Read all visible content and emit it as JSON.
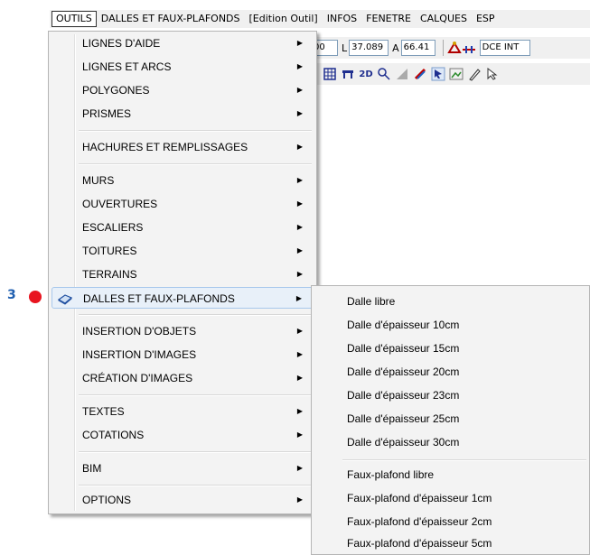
{
  "menubar": {
    "items": [
      "OUTILS",
      "DALLES ET FAUX-PLAFONDS",
      "[Edition Outil]",
      "INFOS",
      "FENETRE",
      "CALQUES",
      "ESP"
    ]
  },
  "toolbar": {
    "field_a_value": "00",
    "label_l": "L",
    "field_l_value": "37.089",
    "label_a": "A",
    "field_angle_value": "66.41",
    "layer_value": "DCE INT",
    "view_2d_label": "2D"
  },
  "outils_menu": {
    "items": [
      {
        "label": "LIGNES D'AIDE"
      },
      {
        "label": "LIGNES ET ARCS"
      },
      {
        "label": "POLYGONES"
      },
      {
        "label": "PRISMES"
      },
      {
        "label": "HACHURES ET REMPLISSAGES"
      },
      {
        "label": "MURS"
      },
      {
        "label": "OUVERTURES"
      },
      {
        "label": "ESCALIERS"
      },
      {
        "label": "TOITURES"
      },
      {
        "label": "TERRAINS"
      },
      {
        "label": "DALLES ET FAUX-PLAFONDS"
      },
      {
        "label": "INSERTION D'OBJETS"
      },
      {
        "label": "INSERTION D'IMAGES"
      },
      {
        "label": "CRÉATION D'IMAGES"
      },
      {
        "label": "TEXTES"
      },
      {
        "label": "COTATIONS"
      },
      {
        "label": "BIM"
      },
      {
        "label": "OPTIONS"
      }
    ],
    "highlighted_item": "DALLES ET FAUX-PLAFONDS"
  },
  "submenu": {
    "items": [
      "Dalle libre",
      "Dalle d'épaisseur 10cm",
      "Dalle d'épaisseur 15cm",
      "Dalle d'épaisseur 20cm",
      "Dalle d'épaisseur 23cm",
      "Dalle d'épaisseur 25cm",
      "Dalle d'épaisseur 30cm",
      "Faux-plafond libre",
      "Faux-plafond d'épaisseur 1cm",
      "Faux-plafond d'épaisseur 2cm",
      "Faux-plafond d'épaisseur 5cm"
    ]
  },
  "annotation": {
    "number": "3",
    "dot_color": "#e8141f",
    "number_color": "#1f5fb0"
  },
  "colors": {
    "menu_bg": "#f3f3f3",
    "highlight_bg": "#e8f0f9",
    "highlight_border": "#a8c8ec"
  }
}
